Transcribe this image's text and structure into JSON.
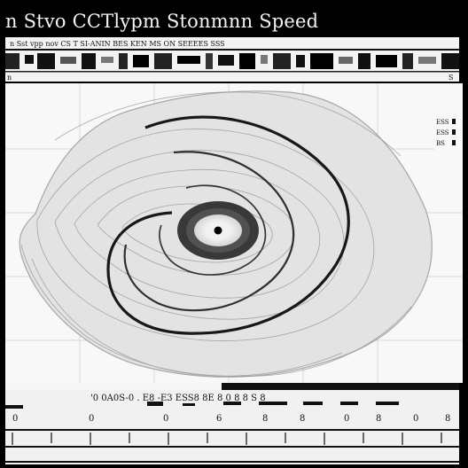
{
  "window": {
    "title": "n Stvo CCTlypm Stonmnn Speed"
  },
  "toolbar": {
    "header_text": "n Sst vpp nov CS T SI-ANIN BES KEN MS ON SEEEES SSS",
    "left_label": "n",
    "right_label": "S"
  },
  "side_panel": {
    "items": [
      "ESS",
      "ESS",
      "BS"
    ]
  },
  "bottom_scale": {
    "labels": [
      "0",
      "0",
      "0",
      "6",
      "8",
      "8",
      "0",
      "8",
      "0",
      "8"
    ],
    "top_glyphs": "'0 0A0S-0 . E8 -E3 ESS8 8E 8 0 8 8 S 8"
  },
  "colors": {
    "background": "#000000",
    "panel": "#f4f4f4",
    "ink": "#111111",
    "gridline": "#d8d8d8"
  }
}
